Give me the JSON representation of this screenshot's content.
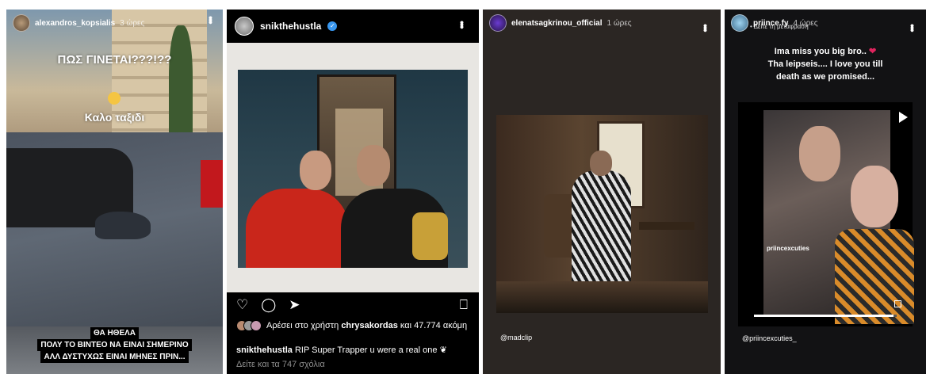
{
  "story1": {
    "username": "alexandros_kopsialis",
    "time": "3 ώρες",
    "headline": "ΠΩΣ ΓΙΝΕΤΑΙ???!??",
    "subline": "Καλο ταξιδι",
    "caption_lines": [
      "ΘΑ ΗΘΕΛΑ",
      "ΠΟΛΥ ΤΟ ΒΙΝΤΕΟ ΝΑ ΕΙΝΑΙ ΣΗΜΕΡΙΝΟ",
      "ΑΛΛ ΔΥΣΤΥΧΩΣ ΕΙΝΑΙ ΜΗΝΕΣ ΠΡΙΝ..."
    ]
  },
  "post2": {
    "username": "snikthehustla",
    "verified_icon": "✓",
    "likes_prefix": "Αρέσει στο χρήστη ",
    "likes_user": "chrysakordas",
    "likes_suffix": " και 47.774 ακόμη",
    "caption_user": "snikthehustla",
    "caption_text": " RIP Super Trapper u were a real one ",
    "caption_icon": "❦",
    "comments_link": "Δείτε και τα 747 σχόλια",
    "icons": {
      "like": "♡",
      "comment": "◯",
      "share": "➤",
      "save": "⎕"
    }
  },
  "story3": {
    "username": "elenatsagkrinou_official",
    "time": "1 ώρες",
    "mention": "@madclip"
  },
  "story4": {
    "username": "priince.fy",
    "time": "4 ώρες",
    "translate": "• Δείτε τη μετάφραση",
    "lines": [
      "Ima miss you big bro.. ",
      "Tha leipseis.... I love you till",
      "death as we promised..."
    ],
    "heart": "❤",
    "video_label": "priincexcuties",
    "video_progress": 0.98,
    "mention": "@priincexcuties_"
  },
  "colors": {
    "verified": "#3897f0",
    "heart": "#e0245e"
  }
}
